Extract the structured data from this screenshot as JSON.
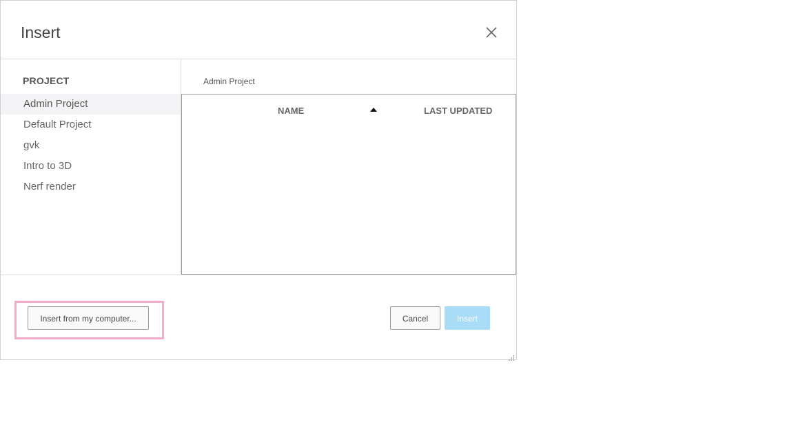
{
  "dialog": {
    "title": "Insert",
    "close_icon": "close-x-icon"
  },
  "sidebar": {
    "heading": "PROJECT",
    "selected_index": 0,
    "items": [
      {
        "label": "Admin Project"
      },
      {
        "label": "Default Project"
      },
      {
        "label": "gvk"
      },
      {
        "label": "Intro to 3D"
      },
      {
        "label": "Nerf render"
      }
    ]
  },
  "main": {
    "breadcrumb": "Admin Project",
    "table": {
      "columns": [
        {
          "label": "NAME",
          "sort": "ascending"
        },
        {
          "label": "LAST UPDATED"
        }
      ],
      "rows": []
    }
  },
  "footer": {
    "upload_label": "Insert from my computer...",
    "cancel_label": "Cancel",
    "insert_label": "Insert",
    "highlight_color": "#f6a9c9",
    "insert_color": "#a9dcf6"
  }
}
